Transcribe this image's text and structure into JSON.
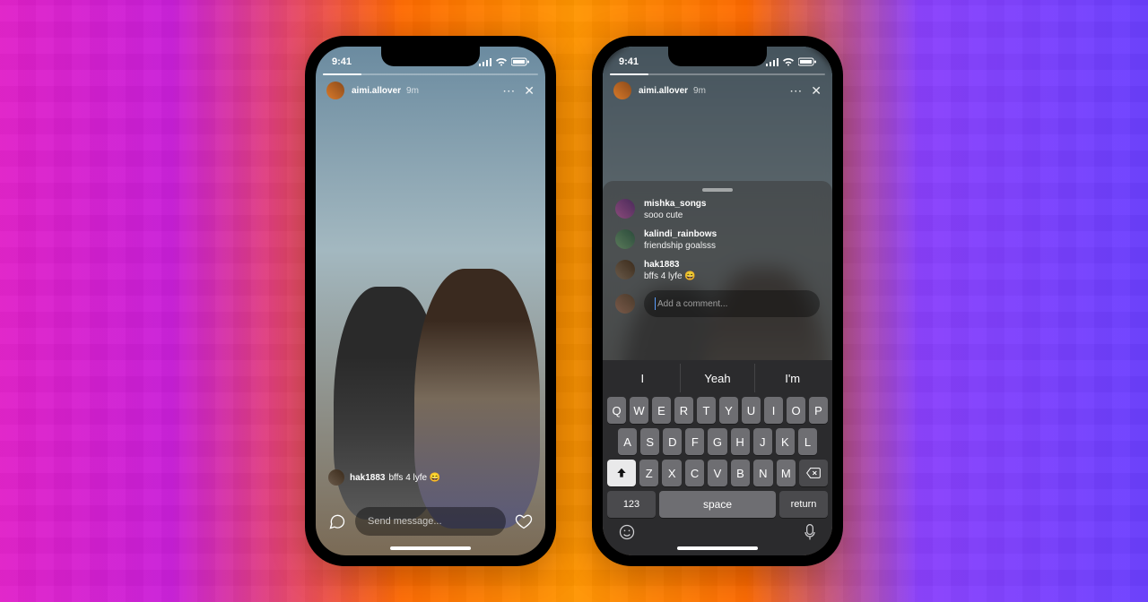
{
  "status": {
    "time": "9:41"
  },
  "story": {
    "username": "aimi.allover",
    "time_ago": "9m"
  },
  "overlay_comment": {
    "username": "hak1883",
    "text": "bffs 4 lyfe 😄"
  },
  "message_input": {
    "placeholder": "Send message..."
  },
  "comments": [
    {
      "username": "mishka_songs",
      "text": "sooo cute"
    },
    {
      "username": "kalindi_rainbows",
      "text": "friendship goalsss"
    },
    {
      "username": "hak1883",
      "text": "bffs 4 lyfe 😄"
    }
  ],
  "comment_input": {
    "placeholder": "Add a comment..."
  },
  "keyboard": {
    "suggestions": [
      "I",
      "Yeah",
      "I'm"
    ],
    "row1": [
      "Q",
      "W",
      "E",
      "R",
      "T",
      "Y",
      "U",
      "I",
      "O",
      "P"
    ],
    "row2": [
      "A",
      "S",
      "D",
      "F",
      "G",
      "H",
      "J",
      "K",
      "L"
    ],
    "row3": [
      "Z",
      "X",
      "C",
      "V",
      "B",
      "N",
      "M"
    ],
    "numbers_key": "123",
    "space_key": "space",
    "return_key": "return"
  }
}
